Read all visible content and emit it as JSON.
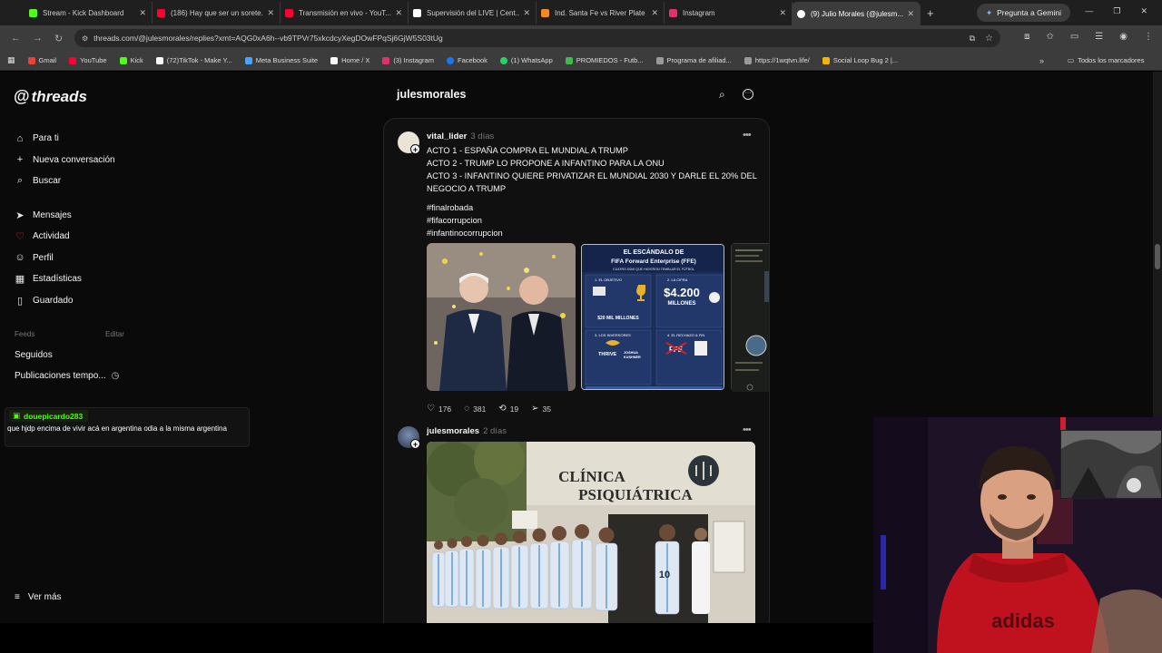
{
  "browser": {
    "tabs": [
      {
        "title": "Stream - Kick Dashboard",
        "color": "#53fc18",
        "active": false
      },
      {
        "title": "(186) Hay que ser un sorete...",
        "color": "#ff0033",
        "active": false
      },
      {
        "title": "Transmisión en vivo - YouT...",
        "color": "#ff0033",
        "active": false
      },
      {
        "title": "Supervisión del LIVE | Cent...",
        "color": "#ffffff",
        "active": false
      },
      {
        "title": "Ind. Santa Fe vs River Plate",
        "color": "#f28b22",
        "active": false
      },
      {
        "title": "Instagram",
        "color": "#e1306c",
        "active": false
      },
      {
        "title": "(9) Julio Morales (@julesm...",
        "color": "#ffffff",
        "active": true
      }
    ],
    "new_tab": "+",
    "gemini_button": "Pregunta a Gemini",
    "url": "threads.com/@julesmorales/replies?xmt=AQG0xA6h--vb9TPVr75xkcdcyXegDOwFPqSj6GjW5S03tUg",
    "bookmarks": [
      {
        "label": "Gmail",
        "color": "#ea4335"
      },
      {
        "label": "YouTube",
        "color": "#ff0033"
      },
      {
        "label": "Kick",
        "color": "#53fc18"
      },
      {
        "label": "(72)TikTok - Make Y...",
        "color": "#ffffff"
      },
      {
        "label": "Meta Business Suite",
        "color": "#4aa3ff"
      },
      {
        "label": "Home / X",
        "color": "#ffffff"
      },
      {
        "label": "(3) Instagram",
        "color": "#e1306c"
      },
      {
        "label": "Facebook",
        "color": "#1877f2"
      },
      {
        "label": "(1) WhatsApp",
        "color": "#25d366"
      },
      {
        "label": "PROMIEDOS - Futb...",
        "color": "#3cba54"
      },
      {
        "label": "Programa de afiliad...",
        "color": "#999999"
      },
      {
        "label": "https://1wqtvn.life/",
        "color": "#999999"
      },
      {
        "label": "Social Loop Bug 2 |...",
        "color": "#f4b400"
      }
    ],
    "bookmarks_more": "»",
    "all_bookmarks": "Todos los marcadores"
  },
  "threads": {
    "logo": "threads",
    "nav": [
      {
        "label": "Para ti",
        "icon": "home-icon",
        "glyph": "⌂"
      },
      {
        "label": "Nueva conversación",
        "icon": "plus-icon",
        "glyph": "+"
      },
      {
        "label": "Buscar",
        "icon": "search-icon",
        "glyph": "⌕"
      },
      {
        "label": "Mensajes",
        "icon": "send-icon",
        "glyph": "➤"
      },
      {
        "label": "Actividad",
        "icon": "heart-icon",
        "glyph": "♡"
      },
      {
        "label": "Perfil",
        "icon": "person-icon",
        "glyph": "☺"
      },
      {
        "label": "Estadísticas",
        "icon": "chart-icon",
        "glyph": "▦"
      },
      {
        "label": "Guardado",
        "icon": "bookmark-icon",
        "glyph": "▯"
      }
    ],
    "feeds_heading": "Feeds",
    "feeds_edit": "Editar",
    "feeds": [
      "Seguidos",
      "Publicaciones tempo..."
    ],
    "see_more": "Ver más",
    "profile_title": "julesmorales"
  },
  "posts": [
    {
      "author": "vital_lider",
      "time": "3 días",
      "lines": [
        "ACTO 1 - ESPAÑA COMPRA EL MUNDIAL A TRUMP",
        "ACTO 2 - TRUMP LO PROPONE A INFANTINO PARA LA ONU",
        "ACTO 3 - INFANTINO QUIERE PRIVATIZAR EL MUNDIAL 2030 Y DARLE EL 20% DEL NEGOCIO A TRUMP"
      ],
      "hashtags": [
        "#finalrobada",
        "#fifacorrupcion",
        "#infantinocorrupcion"
      ],
      "infographic": {
        "title": "EL ESCÁNDALO DE FIFA Forward Enterprise (FFE)",
        "subtitle": "CUATRO DÍAS QUE HICIERON TEMBLAR EL FÚTBOL",
        "s1": "1. EL OBJETIVO",
        "s2": "2. LA CIFRA",
        "amount": "$4.200",
        "amount_unit": "MILLONES",
        "valuation": "$20 MIL MILLONES",
        "s3": "3. LOS INVERSORES",
        "s4": "4. EL RECHAZO & FIN",
        "investor1": "THRIVE",
        "investor2": "JOSHUA KUSHNER",
        "logo": "FFE"
      },
      "likes": "176",
      "comments": "381",
      "reposts": "19",
      "shares": "35"
    },
    {
      "author": "julesmorales",
      "time": "2 días",
      "image_sign": "CLÍNICA PSIQUIÁTRICA",
      "jersey_number": "10"
    }
  ],
  "chat_overlay": {
    "username": "douepicardo283",
    "message": "que hjdp encima de vivir acá en argentina odia a la misma argentina",
    "color": "#53fc18"
  }
}
